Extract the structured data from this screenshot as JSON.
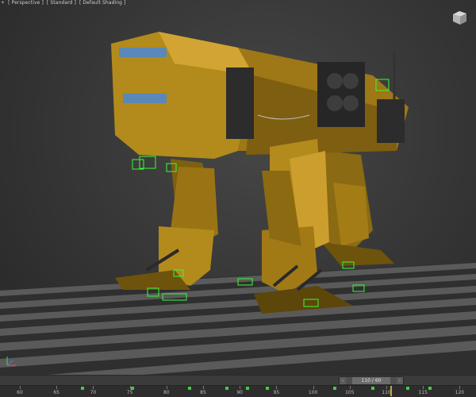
{
  "viewport": {
    "label_parts": [
      "+",
      "[ Perspective ]",
      "[ Standard ]",
      "[ Default Shading ]"
    ],
    "viewcube_icon": "viewcube-icon",
    "axis_icon": "axis-gizmo-icon"
  },
  "timeline": {
    "slider_text": "110 / 60",
    "prev_icon": "chevron-left-icon",
    "next_icon": "chevron-right-icon",
    "start_label": "0",
    "tick_labels": [
      "60",
      "65",
      "70",
      "75",
      "80",
      "85",
      "90",
      "95",
      "100",
      "105",
      "110",
      "115",
      "120"
    ]
  },
  "colors": {
    "mech_body": "#b38a1c",
    "wireframe_green": "#33ff33",
    "grid_light": "#585858",
    "grid_dark": "#2e2e2e",
    "time_cursor": "#c8a341"
  }
}
